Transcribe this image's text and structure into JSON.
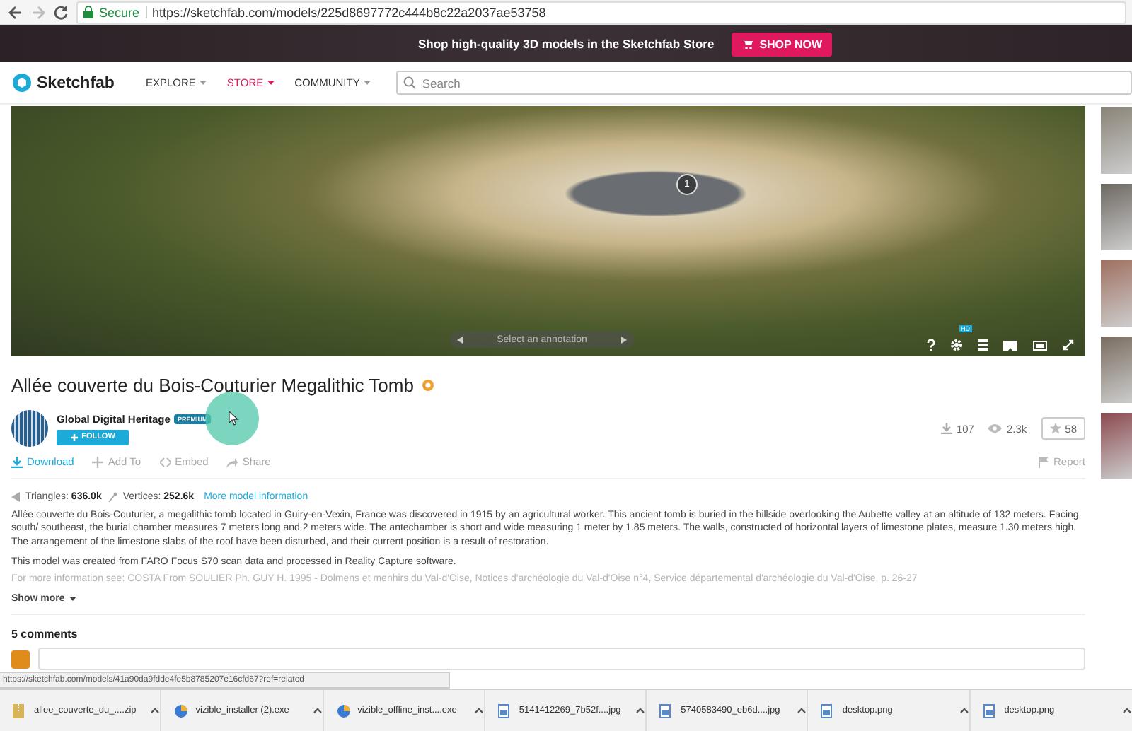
{
  "browser": {
    "security": "Secure",
    "url": "https://sketchfab.com/models/225d8697772c444b8c22a2037ae53758"
  },
  "promo": {
    "text": "Shop high-quality 3D models in the Sketchfab Store",
    "button": "SHOP NOW"
  },
  "nav": {
    "logo": "Sketchfab",
    "items": [
      {
        "label": "EXPLORE",
        "selected": false
      },
      {
        "label": "STORE",
        "selected": true
      },
      {
        "label": "COMMUNITY",
        "selected": false
      }
    ],
    "search": {
      "placeholder": "Search"
    }
  },
  "viewer": {
    "annotation_number": "1",
    "annotation_select": "Select an annotation",
    "settings_badge": "HD"
  },
  "model": {
    "title": "Allée couverte du Bois-Couturier Megalithic Tomb",
    "author": "Global Digital Heritage",
    "author_badge": "PREMIUM",
    "follow": "FOLLOW",
    "downloads": "107",
    "views": "2.3k",
    "likes": "58",
    "actions": [
      {
        "kind": "download",
        "label": "Download"
      },
      {
        "kind": "add",
        "label": "Add To"
      },
      {
        "kind": "embed",
        "label": "Embed"
      },
      {
        "kind": "share",
        "label": "Share"
      }
    ],
    "report": "Report",
    "specs": {
      "triangles_label": "Triangles:",
      "triangles": "636.0k",
      "vertices_label": "Vertices:",
      "vertices": "252.6k",
      "more": "More model information"
    },
    "description": [
      {
        "kind": "normal",
        "text": "Allée couverte du Bois-Couturier, a megalithic tomb located in Guiry-en-Vexin, France was discovered in 1915 by an agricultural worker. This ancient tomb is buried in the hillside overlooking the Aubette valley at an altitude of 132 meters. Facing south/ southeast, the burial chamber measures 7 meters long and 2 meters wide. The antechamber is short and wide measuring 1 meter by 1.85 meters. The walls, constructed of horizontal layers of limestone plates, measure 1.30 meters high. The arrangement of the limestone slabs of the roof have been disturbed, and their current position is a result of restoration."
      },
      {
        "kind": "normal",
        "text": "This model was created from FARO Focus S70 scan data and processed in Reality Capture software."
      },
      {
        "kind": "faded",
        "text": "For more information see: COSTA From SOULIER Ph. GUY H. 1995 - Dolmens et menhirs du Val-d'Oise, Notices d'archéologie du Val-d'Oise n°4, Service départemental d'archéologie du Val-d'Oise, p. 26-27"
      }
    ],
    "show_more": "Show more",
    "comments": "5 comments"
  },
  "status_url": "https://sketchfab.com/models/41a90da9fdde4fe5b8785207e16cfd67?ref=related",
  "downloads": [
    {
      "kind": "archive",
      "name": "allee_couverte_du_....zip"
    },
    {
      "kind": "installer",
      "name": "vizible_installer (2).exe"
    },
    {
      "kind": "installer",
      "name": "vizible_offline_inst....exe"
    },
    {
      "kind": "image",
      "name": "5141412269_7b52f....jpg"
    },
    {
      "kind": "image",
      "name": "5740583490_eb6d....jpg"
    },
    {
      "kind": "image",
      "name": "desktop.png"
    },
    {
      "kind": "image",
      "name": "desktop.png"
    }
  ]
}
